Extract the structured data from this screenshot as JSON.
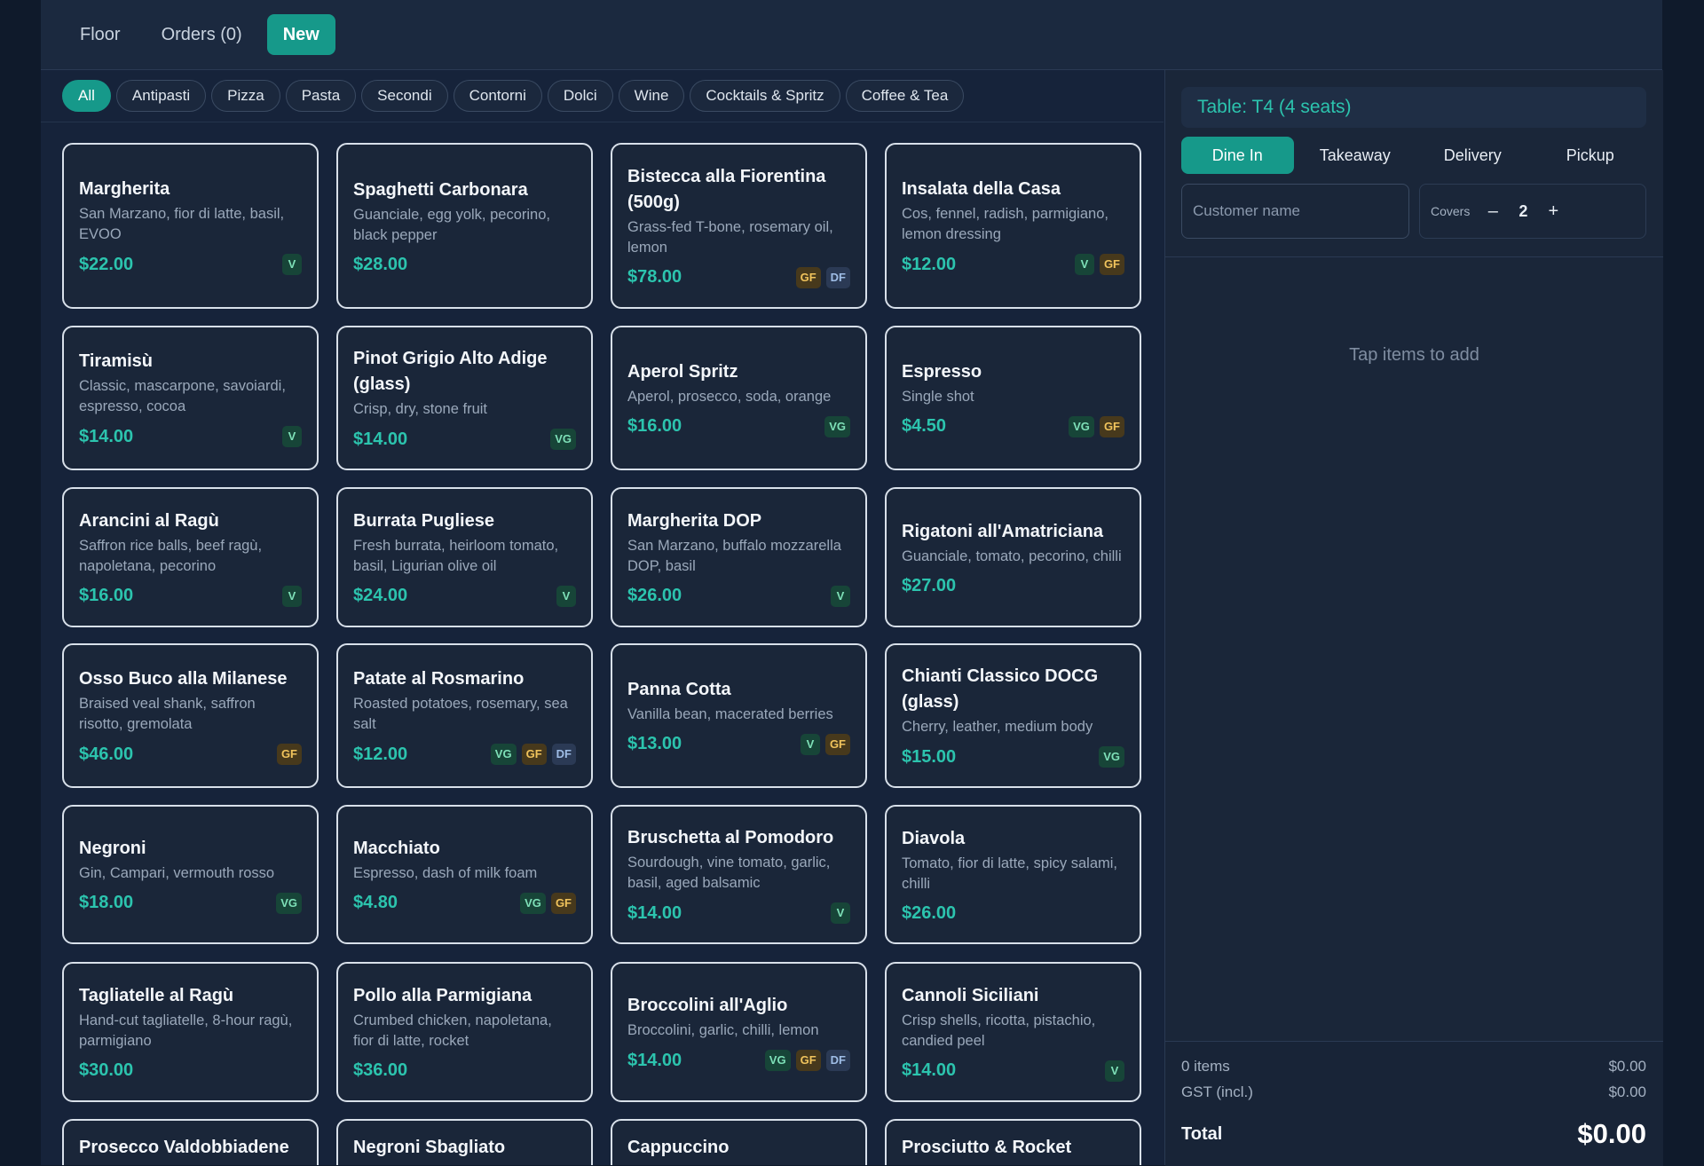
{
  "nav": {
    "tabs": [
      {
        "label": "Floor"
      },
      {
        "label": "Orders (0)"
      },
      {
        "label": "New"
      }
    ]
  },
  "categories": [
    "All",
    "Antipasti",
    "Pizza",
    "Pasta",
    "Secondi",
    "Contorni",
    "Dolci",
    "Wine",
    "Cocktails & Spritz",
    "Coffee & Tea"
  ],
  "menu": [
    {
      "name": "Margherita",
      "desc": "San Marzano, fior di latte, basil, EVOO",
      "price": "$22.00",
      "tags": [
        "V"
      ]
    },
    {
      "name": "Spaghetti Carbonara",
      "desc": "Guanciale, egg yolk, pecorino, black pepper",
      "price": "$28.00",
      "tags": []
    },
    {
      "name": "Bistecca alla Fiorentina (500g)",
      "desc": "Grass-fed T-bone, rosemary oil, lemon",
      "price": "$78.00",
      "tags": [
        "GF",
        "DF"
      ]
    },
    {
      "name": "Insalata della Casa",
      "desc": "Cos, fennel, radish, parmigiano, lemon dressing",
      "price": "$12.00",
      "tags": [
        "V",
        "GF"
      ]
    },
    {
      "name": "Tiramisù",
      "desc": "Classic, mascarpone, savoiardi, espresso, cocoa",
      "price": "$14.00",
      "tags": [
        "V"
      ]
    },
    {
      "name": "Pinot Grigio Alto Adige (glass)",
      "desc": "Crisp, dry, stone fruit",
      "price": "$14.00",
      "tags": [
        "VG"
      ]
    },
    {
      "name": "Aperol Spritz",
      "desc": "Aperol, prosecco, soda, orange",
      "price": "$16.00",
      "tags": [
        "VG"
      ]
    },
    {
      "name": "Espresso",
      "desc": "Single shot",
      "price": "$4.50",
      "tags": [
        "VG",
        "GF"
      ]
    },
    {
      "name": "Arancini al Ragù",
      "desc": "Saffron rice balls, beef ragù, napoletana, pecorino",
      "price": "$16.00",
      "tags": [
        "V"
      ]
    },
    {
      "name": "Burrata Pugliese",
      "desc": "Fresh burrata, heirloom tomato, basil, Ligurian olive oil",
      "price": "$24.00",
      "tags": [
        "V"
      ]
    },
    {
      "name": "Margherita DOP",
      "desc": "San Marzano, buffalo mozzarella DOP, basil",
      "price": "$26.00",
      "tags": [
        "V"
      ]
    },
    {
      "name": "Rigatoni all'Amatriciana",
      "desc": "Guanciale, tomato, pecorino, chilli",
      "price": "$27.00",
      "tags": []
    },
    {
      "name": "Osso Buco alla Milanese",
      "desc": "Braised veal shank, saffron risotto, gremolata",
      "price": "$46.00",
      "tags": [
        "GF"
      ]
    },
    {
      "name": "Patate al Rosmarino",
      "desc": "Roasted potatoes, rosemary, sea salt",
      "price": "$12.00",
      "tags": [
        "VG",
        "GF",
        "DF"
      ]
    },
    {
      "name": "Panna Cotta",
      "desc": "Vanilla bean, macerated berries",
      "price": "$13.00",
      "tags": [
        "V",
        "GF"
      ]
    },
    {
      "name": "Chianti Classico DOCG (glass)",
      "desc": "Cherry, leather, medium body",
      "price": "$15.00",
      "tags": [
        "VG"
      ]
    },
    {
      "name": "Negroni",
      "desc": "Gin, Campari, vermouth rosso",
      "price": "$18.00",
      "tags": [
        "VG"
      ]
    },
    {
      "name": "Macchiato",
      "desc": "Espresso, dash of milk foam",
      "price": "$4.80",
      "tags": [
        "VG",
        "GF"
      ]
    },
    {
      "name": "Bruschetta al Pomodoro",
      "desc": "Sourdough, vine tomato, garlic, basil, aged balsamic",
      "price": "$14.00",
      "tags": [
        "V"
      ]
    },
    {
      "name": "Diavola",
      "desc": "Tomato, fior di latte, spicy salami, chilli",
      "price": "$26.00",
      "tags": []
    },
    {
      "name": "Tagliatelle al Ragù",
      "desc": "Hand-cut tagliatelle, 8-hour ragù, parmigiano",
      "price": "$30.00",
      "tags": []
    },
    {
      "name": "Pollo alla Parmigiana",
      "desc": "Crumbed chicken, napoletana, fior di latte, rocket",
      "price": "$36.00",
      "tags": []
    },
    {
      "name": "Broccolini all'Aglio",
      "desc": "Broccolini, garlic, chilli, lemon",
      "price": "$14.00",
      "tags": [
        "VG",
        "GF",
        "DF"
      ]
    },
    {
      "name": "Cannoli Siciliani",
      "desc": "Crisp shells, ricotta, pistachio, candied peel",
      "price": "$14.00",
      "tags": [
        "V"
      ]
    },
    {
      "name": "Prosecco Valdobbiadene (glass)",
      "desc": "",
      "price": "",
      "tags": []
    },
    {
      "name": "Negroni Sbagliato",
      "desc": "",
      "price": "",
      "tags": []
    },
    {
      "name": "Cappuccino",
      "desc": "",
      "price": "",
      "tags": []
    },
    {
      "name": "Prosciutto & Rocket",
      "desc": "",
      "price": "",
      "tags": []
    }
  ],
  "order": {
    "table_label": "Table: T4 (4 seats)",
    "types": [
      "Dine In",
      "Takeaway",
      "Delivery",
      "Pickup"
    ],
    "customer_placeholder": "Customer name",
    "covers_label": "Covers",
    "covers_minus": "–",
    "covers_value": "2",
    "covers_plus": "+",
    "empty_text": "Tap items to add",
    "items_label": "0 items",
    "items_value": "$0.00",
    "gst_label": "GST (incl.)",
    "gst_value": "$0.00",
    "total_label": "Total",
    "total_value": "$0.00"
  }
}
